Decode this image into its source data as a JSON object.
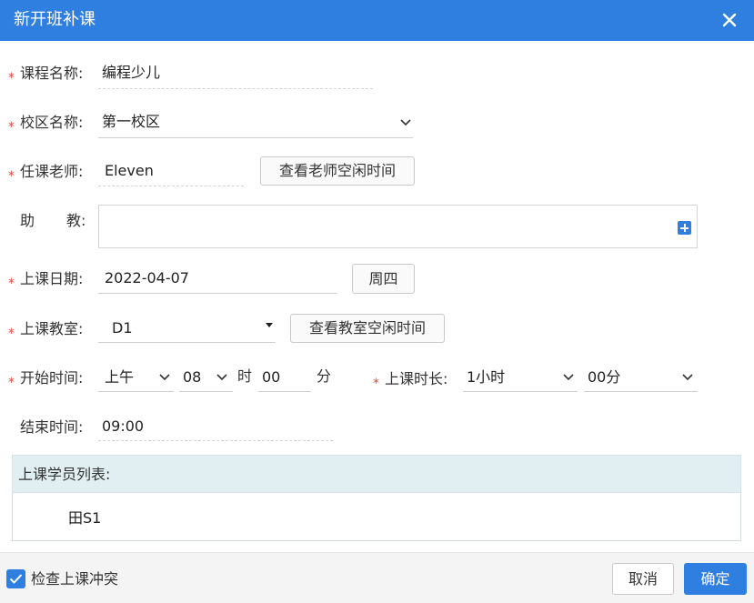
{
  "dialog": {
    "title": "新开班补课"
  },
  "form": {
    "course": {
      "label": "课程名称:",
      "value": "编程少儿"
    },
    "campus": {
      "label": "校区名称:",
      "value": "第一校区"
    },
    "teacher": {
      "label": "任课老师:",
      "value": "Eleven",
      "button": "查看老师空闲时间"
    },
    "assistant": {
      "label_a": "助",
      "label_b": "教:",
      "value": ""
    },
    "date": {
      "label": "上课日期:",
      "value": "2022-04-07",
      "weekday": "周四"
    },
    "classroom": {
      "label": "上课教室:",
      "value": "D1",
      "button": "查看教室空闲时间"
    },
    "start": {
      "label": "开始时间:",
      "period": "上午",
      "hour": "08",
      "hour_unit": "时",
      "minute": "00",
      "minute_unit": "分"
    },
    "duration": {
      "label": "上课时长:",
      "hours": "1小时",
      "minutes": "00分"
    },
    "end": {
      "label": "结束时间:",
      "value": "09:00"
    }
  },
  "students": {
    "header": "上课学员列表:",
    "items": [
      "田S1"
    ]
  },
  "footer": {
    "check_conflict": "检查上课冲突",
    "checked": true,
    "cancel": "取消",
    "confirm": "确定"
  },
  "colors": {
    "primary": "#2f7fe0",
    "required": "#e04b3a",
    "section_bg": "#e1eff2"
  }
}
